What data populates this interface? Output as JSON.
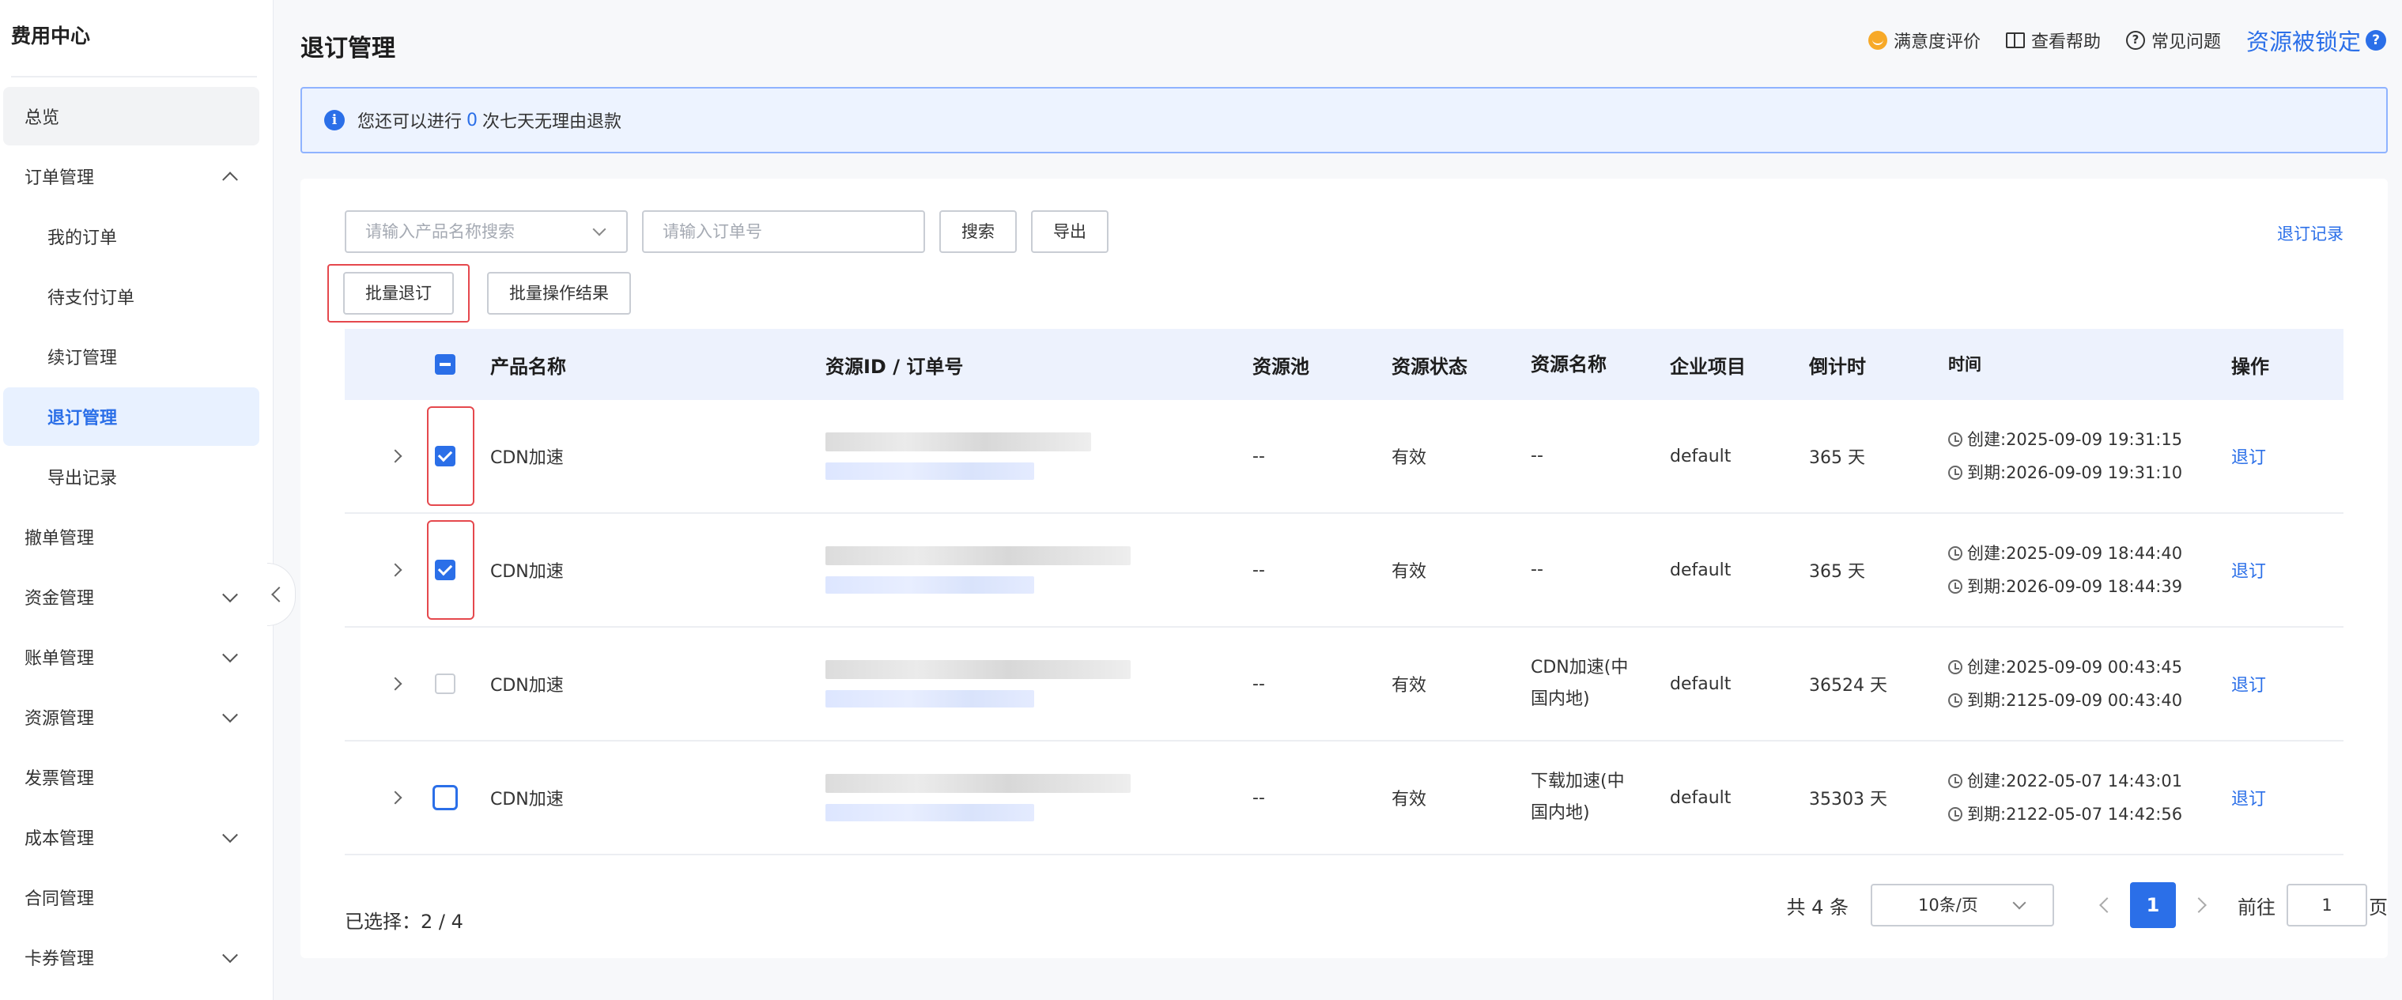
{
  "sidebar": {
    "title": "费用中心",
    "items": [
      {
        "label": "总览",
        "type": "top",
        "state": "hover"
      },
      {
        "label": "订单管理",
        "type": "top",
        "chevron": "up"
      },
      {
        "label": "我的订单",
        "type": "sub"
      },
      {
        "label": "待支付订单",
        "type": "sub"
      },
      {
        "label": "续订管理",
        "type": "sub"
      },
      {
        "label": "退订管理",
        "type": "sub",
        "state": "active"
      },
      {
        "label": "导出记录",
        "type": "sub"
      },
      {
        "label": "撤单管理",
        "type": "top"
      },
      {
        "label": "资金管理",
        "type": "top",
        "chevron": "down"
      },
      {
        "label": "账单管理",
        "type": "top",
        "chevron": "down"
      },
      {
        "label": "资源管理",
        "type": "top",
        "chevron": "down"
      },
      {
        "label": "发票管理",
        "type": "top"
      },
      {
        "label": "成本管理",
        "type": "top",
        "chevron": "down"
      },
      {
        "label": "合同管理",
        "type": "top"
      },
      {
        "label": "卡券管理",
        "type": "top",
        "chevron": "down"
      }
    ]
  },
  "header": {
    "title": "退订管理",
    "links": {
      "satisfaction": "满意度评价",
      "help": "查看帮助",
      "faq": "常见问题",
      "locked": "资源被锁定",
      "locked_badge": "?"
    }
  },
  "banner": {
    "icon": "i",
    "prefix": "您还可以进行",
    "count": "0",
    "suffix": "次七天无理由退款"
  },
  "toolbar": {
    "product_placeholder": "请输入产品名称搜索",
    "order_placeholder": "请输入订单号",
    "search_label": "搜索",
    "export_label": "导出",
    "refund_log": "退订记录",
    "batch_refund": "批量退订",
    "batch_result": "批量操作结果"
  },
  "table": {
    "headers": [
      "产品名称",
      "资源ID / 订单号",
      "资源池",
      "资源状态",
      "资源名称",
      "企业项目",
      "倒计时",
      "时间",
      "操作"
    ],
    "rows": [
      {
        "product": "CDN加速",
        "pool": "--",
        "status": "有效",
        "rname": "--",
        "project": "default",
        "countdown": "365 天",
        "created": "创建:2025-09-09 19:31:15",
        "expires": "到期:2026-09-09 19:31:10",
        "op": "退订",
        "checked": true,
        "highlight": true
      },
      {
        "product": "CDN加速",
        "pool": "--",
        "status": "有效",
        "rname": "--",
        "project": "default",
        "countdown": "365 天",
        "created": "创建:2025-09-09 18:44:40",
        "expires": "到期:2026-09-09 18:44:39",
        "op": "退订",
        "checked": true,
        "highlight": true
      },
      {
        "product": "CDN加速",
        "pool": "--",
        "status": "有效",
        "rname": "CDN加速(中国内地)",
        "project": "default",
        "countdown": "36524 天",
        "created": "创建:2025-09-09 00:43:45",
        "expires": "到期:2125-09-09 00:43:40",
        "op": "退订",
        "checked": false
      },
      {
        "product": "CDN加速",
        "pool": "--",
        "status": "有效",
        "rname": "下载加速(中国内地)",
        "project": "default",
        "countdown": "35303 天",
        "created": "创建:2022-05-07 14:43:01",
        "expires": "到期:2122-05-07 14:42:56",
        "op": "退订",
        "checked": false,
        "focus": true
      }
    ]
  },
  "footer": {
    "selected": "已选择：2 / 4",
    "total": "共 4 条",
    "page_size": "10条/页",
    "current_page": "1",
    "goto_label": "前往",
    "goto_value": "1",
    "goto_suffix": "页"
  }
}
